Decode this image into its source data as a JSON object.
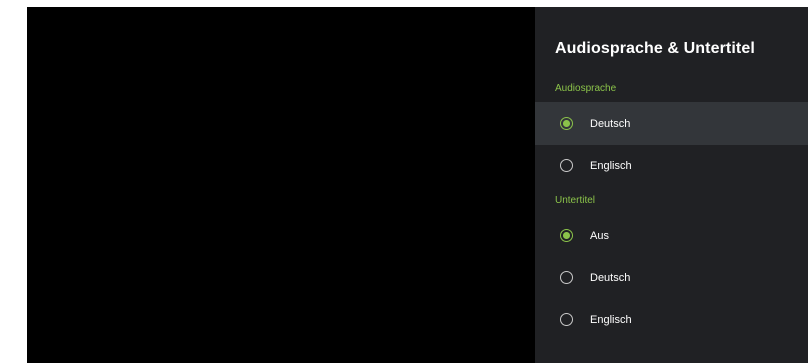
{
  "panel": {
    "title": "Audiosprache & Untertitel",
    "sections": [
      {
        "header": "Audiosprache",
        "options": [
          {
            "label": "Deutsch",
            "selected": true,
            "focused": true
          },
          {
            "label": "Englisch",
            "selected": false,
            "focused": false
          }
        ]
      },
      {
        "header": "Untertitel",
        "options": [
          {
            "label": "Aus",
            "selected": true,
            "focused": false
          },
          {
            "label": "Deutsch",
            "selected": false,
            "focused": false
          },
          {
            "label": "Englisch",
            "selected": false,
            "focused": false
          }
        ]
      }
    ]
  },
  "colors": {
    "accent": "#8bc34a",
    "panel_background": "#202124",
    "focused_row": "#33363a",
    "video_background": "#000000"
  }
}
